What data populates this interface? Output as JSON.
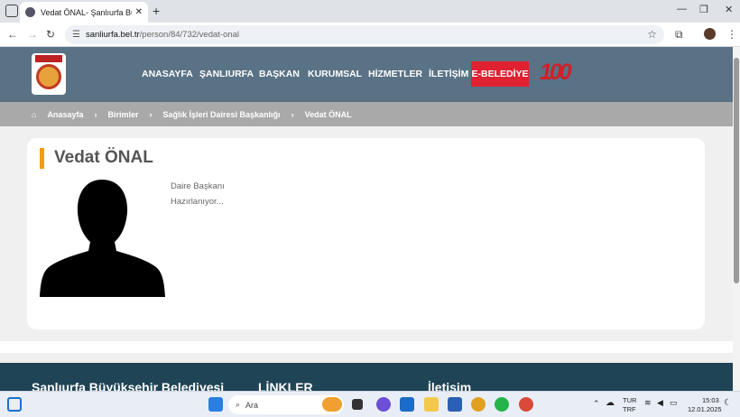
{
  "browser": {
    "tab_title": "Vedat ÖNAL- Şanlıurfa Büyükşehir Belediyesi",
    "url_host": "sanliurfa.bel.tr",
    "url_path": "/person/84/732/vedat-onal"
  },
  "site": {
    "nav": [
      "ANASAYFA",
      "ŞANLIURFA",
      "BAŞKAN",
      "KURUMSAL",
      "HİZMETLER",
      "İLETİŞİM"
    ],
    "ebelediye": "E-BELEDİYE",
    "centennial": "100",
    "breadcrumb": [
      "Anasayfa",
      "Birimler",
      "Sağlık İşleri Dairesi Başkanlığı",
      "Vedat ÖNAL"
    ],
    "person": {
      "name": "Vedat ÖNAL",
      "role": "Daire Başkanı",
      "note": "Hazırlanıyor..."
    },
    "footer": [
      "Şanlıurfa Büyükşehir Belediyesi",
      "LİNKLER",
      "İletişim"
    ]
  },
  "taskbar": {
    "search_placeholder": "Ara",
    "lang1": "TUR",
    "lang2": "TRF",
    "time": "15:03",
    "date": "12.01.2025"
  }
}
